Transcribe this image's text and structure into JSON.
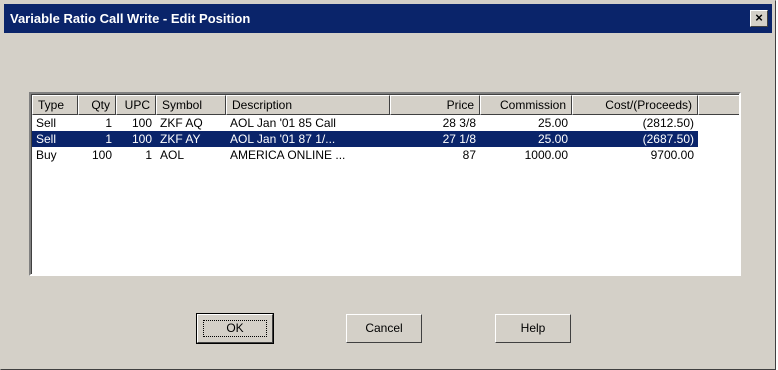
{
  "window": {
    "title": "Variable Ratio Call Write - Edit Position",
    "close_glyph": "×"
  },
  "list": {
    "columns": [
      "Type",
      "Qty",
      "UPC",
      "Symbol",
      "Description",
      "Price",
      "Commission",
      "Cost/(Proceeds)"
    ],
    "rows": [
      {
        "type": "Sell",
        "qty": "1",
        "upc": "100",
        "symbol": "ZKF AQ",
        "description": "AOL  Jan '01  85 Call",
        "price": "28 3/8",
        "commission": "25.00",
        "cost": "(2812.50)",
        "selected": false
      },
      {
        "type": "Sell",
        "qty": "1",
        "upc": "100",
        "symbol": "ZKF AY",
        "description": "AOL  Jan '01  87 1/...",
        "price": "27 1/8",
        "commission": "25.00",
        "cost": "(2687.50)",
        "selected": true
      },
      {
        "type": "Buy",
        "qty": "100",
        "upc": "1",
        "symbol": "AOL",
        "description": "AMERICA ONLINE ...",
        "price": "87",
        "commission": "1000.00",
        "cost": "9700.00",
        "selected": false
      }
    ]
  },
  "buttons": {
    "ok": "OK",
    "cancel": "Cancel",
    "help": "Help"
  },
  "colors": {
    "titlebar": "#0a246a",
    "selection": "#0a246a",
    "face": "#d4d0c8"
  }
}
